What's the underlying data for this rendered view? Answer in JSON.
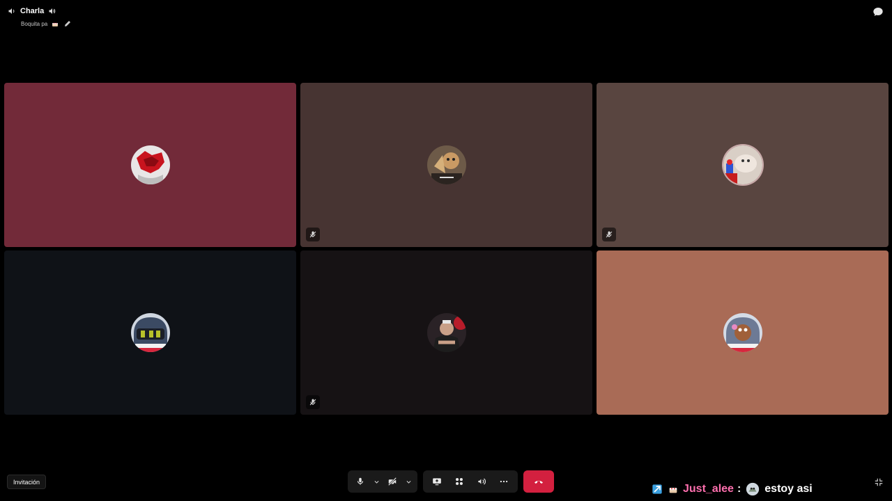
{
  "header": {
    "channel_name": "Charla",
    "status_text": "Boquita pa"
  },
  "invite_label": "Invitación",
  "chat_overlay": {
    "username": "Just_alee",
    "separator": ":",
    "message": "estoy asi"
  },
  "colors": {
    "tile_1": "#722a39",
    "tile_2": "#473432",
    "tile_3": "#594540",
    "tile_4": "#0f1217",
    "tile_5": "#161214",
    "tile_6": "#a96b56",
    "end_call": "#d3203f",
    "username": "#ff6fae"
  },
  "tiles": [
    {
      "muted": false
    },
    {
      "muted": true
    },
    {
      "muted": true
    },
    {
      "muted": false
    },
    {
      "muted": true
    },
    {
      "muted": false
    }
  ],
  "icons": {
    "speaker": "speaker-icon",
    "chat": "chat-bubble-icon",
    "mic": "microphone-icon",
    "camera_off": "camera-off-icon",
    "screen_share": "screen-share-icon",
    "activities": "activities-icon",
    "soundboard": "soundboard-icon",
    "more": "more-icon",
    "hang_up": "hang-up-icon",
    "fullscreen_exit": "exit-fullscreen-icon",
    "muted": "mic-muted-icon"
  }
}
